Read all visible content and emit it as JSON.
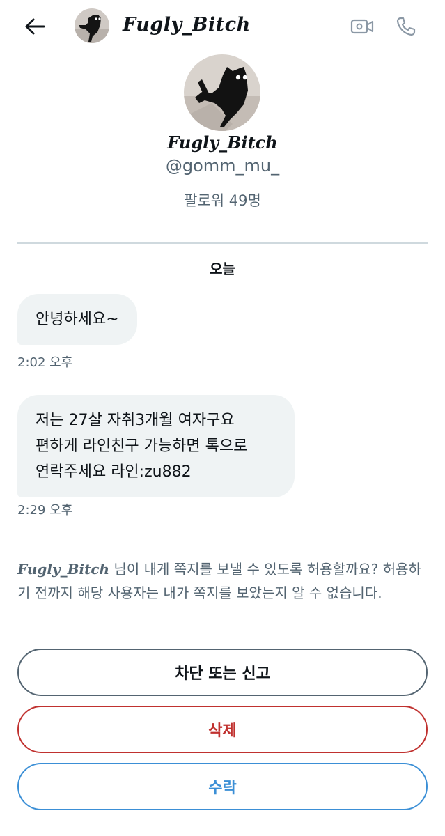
{
  "header": {
    "name": "Fugly_Bitch",
    "icons": {
      "back": "back-arrow-icon",
      "video": "video-camera-icon",
      "phone": "phone-icon"
    }
  },
  "profile": {
    "name": "Fugly_Bitch",
    "handle": "@gomm_mu_",
    "followers": "팔로워 49명"
  },
  "conversation": {
    "date_label": "오늘",
    "messages": [
      {
        "lines": [
          "안녕하세요~"
        ],
        "time": "2:02 오후"
      },
      {
        "lines": [
          "저는 27살 자취3개월 여자구요",
          "편하게 라인친구 가능하면 톡으로",
          "연락주세요 라인:zu882"
        ],
        "time": "2:29 오후"
      }
    ]
  },
  "request": {
    "name": "Fugly_Bitch",
    "text": " 님이 내게 쪽지를 보낼 수 있도록 허용할까요? 허용하기 전까지 해당 사용자는 내가 쪽지를 보았는지 알 수 없습니다."
  },
  "actions": {
    "block_label": "차단 또는 신고",
    "delete_label": "삭제",
    "accept_label": "수락"
  },
  "colors": {
    "bubble": "#eff3f4",
    "secondary_text": "#536471",
    "delete": "#c0312f",
    "accept": "#3b8fd6"
  }
}
